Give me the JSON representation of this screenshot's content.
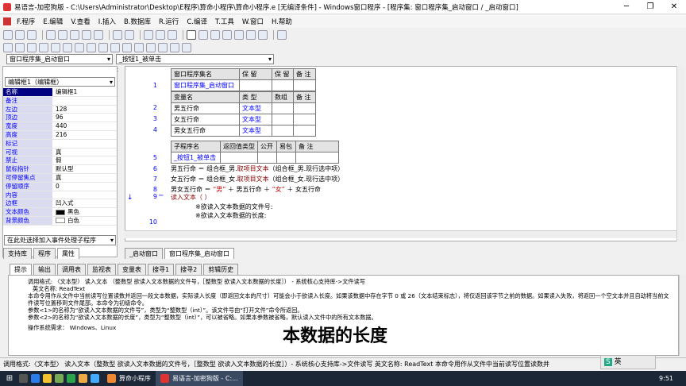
{
  "window": {
    "title": "易语言-加密狗版 - C:\\Users\\Administrator\\Desktop\\E程序\\算命小程序\\算命小程序.e [无编译条件] - Windows窗口程序 - [程序集: 窗口程序集_启动窗口 / _启动窗口]",
    "minimize": "─",
    "restore": "❐",
    "close": "✕"
  },
  "menu": [
    "F.程序",
    "E.编辑",
    "V.查看",
    "I.插入",
    "B.数据库",
    "R.运行",
    "C.编译",
    "T.工具",
    "W.窗口",
    "H.帮助"
  ],
  "combos": {
    "left": "窗口程序集_启动窗口",
    "right": "_按钮1_被单击"
  },
  "props": {
    "object": "编辑框1（编辑框）",
    "rows": [
      [
        "名称",
        "编辑框1"
      ],
      [
        "备注",
        ""
      ],
      [
        "左边",
        "128"
      ],
      [
        "顶边",
        "96"
      ],
      [
        "宽度",
        "440"
      ],
      [
        "高度",
        "216"
      ],
      [
        "标记",
        ""
      ],
      [
        "可视",
        "真"
      ],
      [
        "禁止",
        "假"
      ],
      [
        "鼠标指针",
        "默认型"
      ],
      [
        "可停留焦点",
        "真"
      ],
      [
        "停留顺序",
        "0"
      ],
      [
        "内容",
        ""
      ],
      [
        "边框",
        "凹入式"
      ],
      [
        "文本颜色",
        "黑色"
      ],
      [
        "背景颜色",
        "白色"
      ]
    ],
    "event_combo": "在此处选择加入事件处理子程序",
    "tabs": [
      "支持库",
      "程序",
      "属性"
    ]
  },
  "code": {
    "t1_head": [
      "窗口程序集名",
      "保 留",
      "保 留",
      "备 注"
    ],
    "t1_row": "窗口程序集_启动窗口",
    "t2_head": [
      "变量名",
      "类 型",
      "数组",
      "备 注"
    ],
    "t2_rows": [
      [
        "男五行命",
        "文本型"
      ],
      [
        "女五行命",
        "文本型"
      ],
      [
        "男女五行命",
        "文本型"
      ]
    ],
    "t3_head": [
      "子程序名",
      "返回值类型",
      "公开",
      "易包",
      "备 注"
    ],
    "t3_row": "_按钮1_被单击",
    "lines": [
      "1",
      "2",
      "3",
      "4",
      "5",
      "6",
      "7",
      "8",
      "9",
      "10"
    ],
    "l6a": "男五行命 ＝ 组合框_男.",
    "l6b": "取项目文本",
    "l6c": "（组合框_男.现行选中项）",
    "l7a": "女五行命 ＝ 组合框_女.",
    "l7b": "取项目文本",
    "l7c": "（组合框_女.现行选中项）",
    "l8a": "男女五行命 ＝ ",
    "l8b": "“男”",
    "l8c": " ＋ 男五行命 ＋ ",
    "l8d": "“女”",
    "l8e": " ＋ 女五行命",
    "l9": "读入文本（ ）",
    "hint1": "※欲读入文本数据的文件号:",
    "hint2": "※欲读入文本数据的长度:"
  },
  "editor_tabs": [
    "_启动窗口",
    "窗口程序集_启动窗口"
  ],
  "out_tabs": [
    "提示",
    "输出",
    "调用表",
    "监视表",
    "变量表",
    "搜寻1",
    "搜寻2",
    "剪辑历史"
  ],
  "output": {
    "l1": "调用格式: 〈文本型〉 读入文本 （整数型 欲读入文本数据的文件号，［整数型 欲读入文本数据的长度］） - 系统核心支持库->文件读写",
    "l2": "英文名称: ReadText",
    "l3": "本命令用作从文件中当前读写位置读数并返回一段文本数据，实际读入长度（即返回文本的尺寸）可能会小于欲读入长度。如果该数据中存在字节 0 或 26（文本结束标志），将仅返回该字节之前的数据。如果读入失败，将返回一个空文本并且自动将当前文件读写位置移到文件尾部。本命令为初级命令。",
    "l4": "参数<1>的名称为“欲读入文本数据的文件号”，类型为“整数型（int）”。该文件号由“打开文件”命令所返回。",
    "l5": "参数<2>的名称为“欲读入文本数据的长度”，类型为“整数型（int）”，可以被省略。如果本参数被省略，默认读入文件中的所有文本数据。",
    "l6": "操作系统需求： Windows、Linux",
    "big": "本数据的长度"
  },
  "status": "调用格式:〈文本型〉 读入文本（整数型 欲读入文本数据的文件号，［整数型 欲读入文本数据的长度］）- 系统核心支持库->文件读写   英文名称: ReadText   本命令用作从文件中当前读写位置读数并",
  "taskbar": {
    "task1": "算命小程序",
    "task2": "易语言-加密狗版 - C:...",
    "ime": "英",
    "clock": "9:51"
  }
}
